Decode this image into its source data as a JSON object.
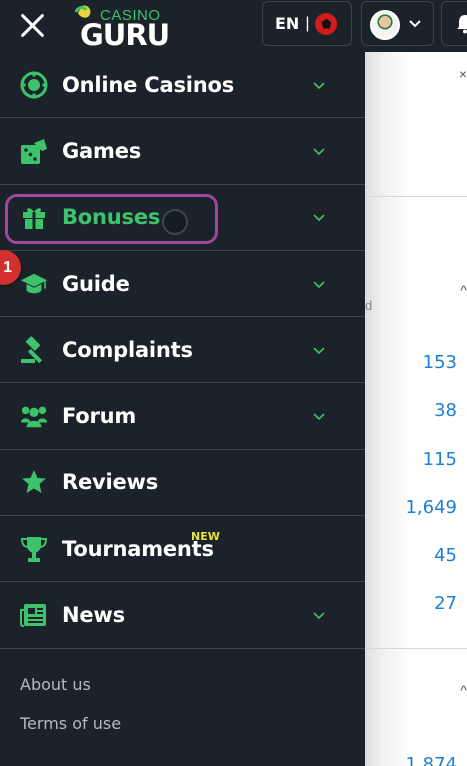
{
  "header": {
    "logo_top": "CASINO",
    "logo_bottom": "GURU",
    "language": "EN",
    "language_separator": "|"
  },
  "menu": {
    "items": [
      {
        "label": "Online Casinos",
        "icon": "casino-chip-icon",
        "has_chevron": true
      },
      {
        "label": "Games",
        "icon": "dice-icon",
        "has_chevron": true
      },
      {
        "label": "Bonuses",
        "icon": "gift-icon",
        "has_chevron": true,
        "active": true
      },
      {
        "label": "Guide",
        "icon": "graduation-cap-icon",
        "has_chevron": true
      },
      {
        "label": "Complaints",
        "icon": "gavel-icon",
        "has_chevron": true
      },
      {
        "label": "Forum",
        "icon": "users-icon",
        "has_chevron": true
      },
      {
        "label": "Reviews",
        "icon": "star-icon",
        "has_chevron": false
      },
      {
        "label": "Tournaments",
        "icon": "trophy-icon",
        "has_chevron": false,
        "badge": "NEW"
      },
      {
        "label": "News",
        "icon": "newspaper-icon",
        "has_chevron": true
      }
    ]
  },
  "footer": {
    "links": [
      "About us",
      "Terms of use"
    ]
  },
  "overlay": {
    "step_number": "1"
  },
  "background": {
    "numbers": [
      "153",
      "38",
      "115",
      "1,649",
      "45",
      "27",
      "1,874"
    ],
    "letter": "d"
  },
  "colors": {
    "background": "#1b2229",
    "accent_green": "#3cc36c",
    "highlight_purple": "#a2479f",
    "badge_red": "#d32f2f",
    "new_yellow": "#e8e33a",
    "link_blue": "#1f7fd6"
  }
}
